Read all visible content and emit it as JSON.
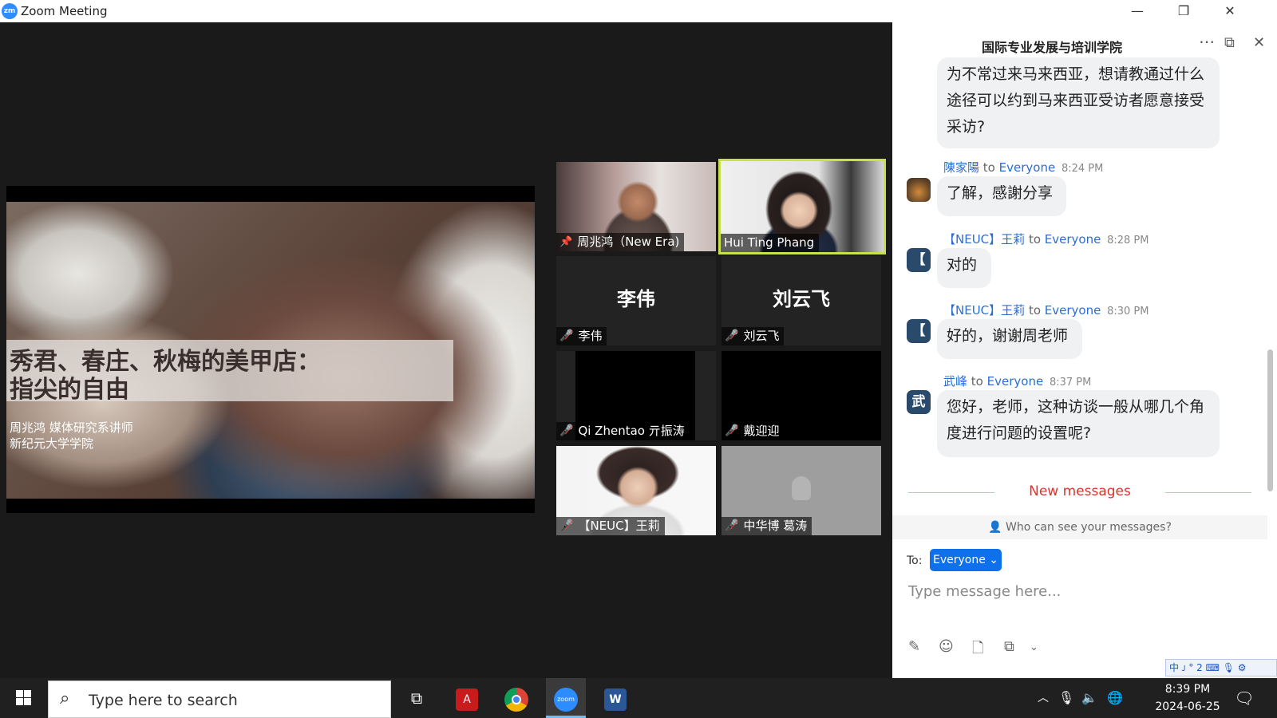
{
  "window": {
    "title": "Zoom Meeting",
    "logo_text": "zm",
    "controls": {
      "minimize": "—",
      "restore": "❐",
      "close": "✕"
    }
  },
  "slide": {
    "title_line1": "秀君、春庄、秋梅的美甲店：",
    "title_line2": "指尖的自由",
    "subtitle_line1": "周兆鸿 媒体研究系讲师",
    "subtitle_line2": "新纪元大学学院"
  },
  "participants": [
    {
      "name": "周兆鸿（New Era)",
      "pinned": true,
      "muted": false,
      "video": "face1"
    },
    {
      "name": "Hui Ting Phang",
      "pinned": false,
      "muted": false,
      "video": "face2",
      "active_speaker": true
    },
    {
      "name": "李伟",
      "muted": true,
      "video": "off",
      "big_label": "李伟"
    },
    {
      "name": "刘云飞",
      "muted": true,
      "video": "off",
      "big_label": "刘云飞"
    },
    {
      "name": "Qi Zhentao 亓振涛",
      "muted": true,
      "video": "black"
    },
    {
      "name": "戴迎迎",
      "muted": true,
      "video": "black"
    },
    {
      "name": "【NEUC】王莉",
      "muted": true,
      "video": "face3"
    },
    {
      "name": "中华博 葛涛",
      "muted": true,
      "video": "face4"
    }
  ],
  "chat": {
    "header_title": "国际专业发展与培训学院",
    "header_icons": [
      "more-icon",
      "popout-icon",
      "close-icon"
    ],
    "messages": [
      {
        "sender": "",
        "to": "",
        "time": "",
        "text_lines": [
          "为不常过来马来西亚，想请教通过什么",
          "途径可以约到马来西亚受访者愿意接受",
          "采访?"
        ]
      },
      {
        "sender": "陳家陽",
        "to_word": "to",
        "to": "Everyone",
        "time": "8:24 PM",
        "avatar": "photo",
        "text_lines": [
          "了解，感謝分享"
        ]
      },
      {
        "sender": "【NEUC】王莉",
        "to_word": "to",
        "to": "Everyone",
        "time": "8:28 PM",
        "avatar": "【",
        "text_lines": [
          "对的"
        ]
      },
      {
        "sender": "【NEUC】王莉",
        "to_word": "to",
        "to": "Everyone",
        "time": "8:30 PM",
        "avatar": "【",
        "text_lines": [
          "好的，谢谢周老师"
        ]
      },
      {
        "sender": "武峰",
        "to_word": "to",
        "to": "Everyone",
        "time": "8:37 PM",
        "avatar": "武",
        "text_lines": [
          "您好，老师，这种访谈一般从哪几个角",
          "度进行问题的设置呢?"
        ]
      }
    ],
    "new_messages_label": "New messages",
    "who_can_see": "Who can see your messages?",
    "to_label": "To:",
    "recipient": "Everyone",
    "input_placeholder": "Type message here...",
    "colors": {
      "link": "#2d6dd2",
      "accent": "#0e71eb",
      "new_messages": "#e0322d"
    }
  },
  "taskbar": {
    "search_placeholder": "Type here to search",
    "apps": [
      "task-view-icon",
      "acrobat-icon",
      "chrome-icon",
      "zoom-icon",
      "word-icon"
    ],
    "time": "8:39 PM",
    "date": "2024-06-25"
  },
  "ime": {
    "text": "中 ᴊ ° 𝟤 ⌨ 🎙 ⚙"
  }
}
